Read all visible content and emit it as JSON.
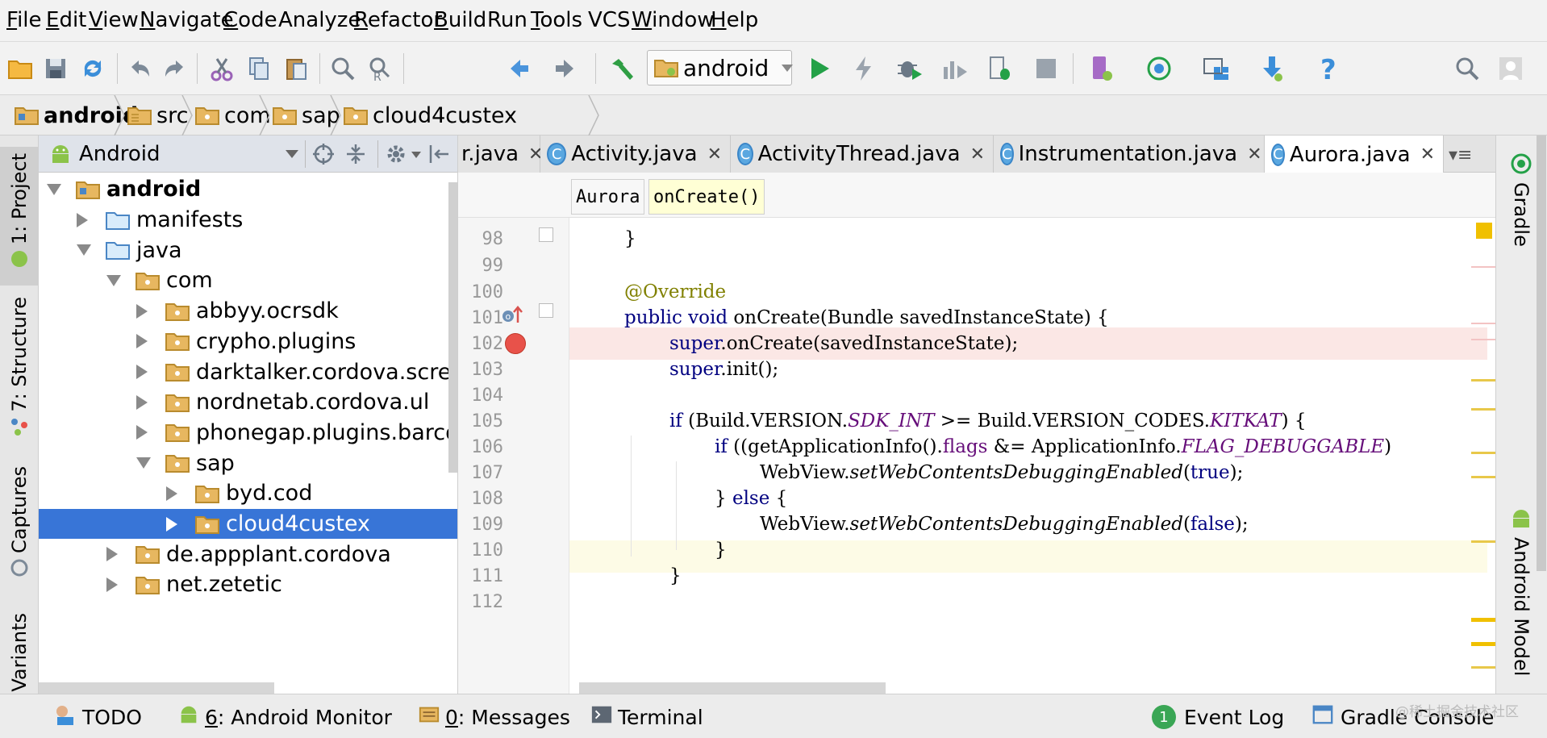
{
  "menu": {
    "items": [
      {
        "mn": "F",
        "rest": "ile"
      },
      {
        "mn": "E",
        "rest": "dit"
      },
      {
        "mn": "V",
        "rest": "iew"
      },
      {
        "mn": "N",
        "rest": "avigate"
      },
      {
        "mn": "C",
        "rest": "ode"
      },
      {
        "mn": "",
        "rest": "Analyze"
      },
      {
        "mn": "R",
        "rest": "efactor"
      },
      {
        "mn": "B",
        "rest": "uild"
      },
      {
        "mn": "",
        "rest": "Run"
      },
      {
        "mn": "T",
        "rest": "ools"
      },
      {
        "mn": "",
        "rest": "VCS"
      },
      {
        "mn": "W",
        "rest": "indow"
      },
      {
        "mn": "H",
        "rest": "elp"
      }
    ]
  },
  "toolbar": {
    "run_config": "android"
  },
  "breadcrumbs": [
    "android",
    "src",
    "com",
    "sap",
    "cloud4custex"
  ],
  "left_strip": {
    "project": "1: Project",
    "structure": "7: Structure",
    "captures": "Captures",
    "variants": "d Variants"
  },
  "right_strip": {
    "gradle": "Gradle",
    "android_model": "Android Model"
  },
  "project_panel": {
    "view_mode": "Android",
    "tree": [
      {
        "label": "android",
        "bold": true,
        "arrow": "down",
        "indent": 0
      },
      {
        "label": "manifests",
        "arrow": "right",
        "indent": 1
      },
      {
        "label": "java",
        "arrow": "down",
        "indent": 1
      },
      {
        "label": "com",
        "arrow": "down",
        "indent": 2
      },
      {
        "label": "abbyy.ocrsdk",
        "arrow": "right",
        "indent": 3
      },
      {
        "label": "crypho.plugins",
        "arrow": "right",
        "indent": 3
      },
      {
        "label": "darktalker.cordova.screenshot",
        "arrow": "right",
        "indent": 3
      },
      {
        "label": "nordnetab.cordova.ul",
        "arrow": "right",
        "indent": 3
      },
      {
        "label": "phonegap.plugins.barcodescanner",
        "arrow": "right",
        "indent": 3
      },
      {
        "label": "sap",
        "arrow": "down",
        "indent": 3
      },
      {
        "label": "byd.cod",
        "arrow": "right",
        "indent": 4
      },
      {
        "label": "cloud4custex",
        "arrow": "right",
        "indent": 4,
        "selected": true
      },
      {
        "label": "de.appplant.cordova",
        "arrow": "right",
        "indent": 2
      },
      {
        "label": "net.zetetic",
        "arrow": "right",
        "indent": 2
      }
    ]
  },
  "editor": {
    "tabs": [
      {
        "label": "r.java",
        "partial": true
      },
      {
        "label": "Activity.java"
      },
      {
        "label": "ActivityThread.java"
      },
      {
        "label": "Instrumentation.java"
      },
      {
        "label": "Aurora.java",
        "active": true
      }
    ],
    "crumbs": [
      "Aurora",
      "onCreate()"
    ],
    "line_numbers": [
      "98",
      "99",
      "100",
      "101",
      "102",
      "103",
      "104",
      "105",
      "106",
      "107",
      "108",
      "109",
      "110",
      "111",
      "112"
    ],
    "code": {
      "l98": "}",
      "l100": "@Override",
      "l101_kw": "public void",
      "l101_rest": " onCreate(Bundle savedInstanceState) {",
      "l102_kw": "super",
      "l102_rest": ".onCreate(savedInstanceState);",
      "l103_kw": "super",
      "l103_rest": ".init();",
      "l105_kw": "if",
      "l105_a": " (Build.VERSION.",
      "l105_sdk": "SDK_INT",
      "l105_b": " >= Build.VERSION_CODES.",
      "l105_kitkat": "KITKAT",
      "l105_c": ") {",
      "l106_kw": "if",
      "l106_a": " ((getApplicationInfo().",
      "l106_flags": "flags",
      "l106_b": " &= ApplicationInfo.",
      "l106_dbg": "FLAG_DEBUGGABLE",
      "l106_c": ")",
      "l107_a": "WebView.",
      "l107_m": "setWebContentsDebuggingEnabled",
      "l107_b": "(",
      "l107_v": "true",
      "l107_c": ");",
      "l108_a": "} ",
      "l108_kw": "else",
      "l108_b": " {",
      "l109_a": "WebView.",
      "l109_m": "setWebContentsDebuggingEnabled",
      "l109_b": "(",
      "l109_v": "false",
      "l109_c": ");",
      "l110": "}",
      "l111": "}"
    }
  },
  "bottom_bar": {
    "todo": "TODO",
    "android_monitor_num": "6",
    "android_monitor": ": Android Monitor",
    "messages_num": "0",
    "messages": ": Messages",
    "terminal": "Terminal",
    "event_log_count": "1",
    "event_log": "Event Log",
    "gradle_console": "Gradle Console"
  },
  "watermark": "@稀土掘金技术社区",
  "colors": {
    "selection": "#3875d7",
    "breakpoint": "#e8524a",
    "breakpoint_line": "#fbe7e5",
    "current_line": "#fdfbe6",
    "keyword": "#000080",
    "annotation": "#808000",
    "static_field": "#660e7a"
  }
}
